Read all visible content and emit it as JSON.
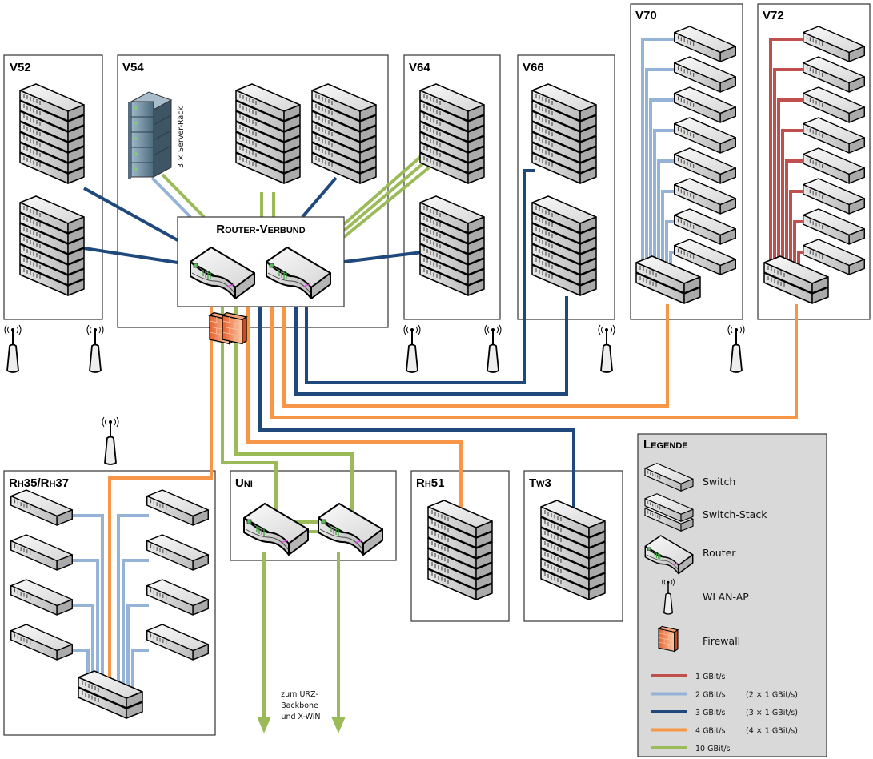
{
  "buildings": {
    "v52": "V52",
    "v54": "V54",
    "v64": "V64",
    "v66": "V66",
    "v70": "V70",
    "v72": "V72",
    "rh35": "Rh35/Rh37",
    "uni": "Uni",
    "rh51": "Rh51",
    "tw3": "Tw3"
  },
  "router_group": "Router-Verbund",
  "server_rack_label": "3 × Server-Rack",
  "uplink_note": [
    "zum URZ-",
    "Backbone",
    "und X-WiN"
  ],
  "colors": {
    "1g": "#c0504d",
    "2g": "#95b3d7",
    "3g": "#1f497d",
    "4g": "#f79646",
    "10g": "#9bbb59"
  },
  "legend": {
    "title": "Legende",
    "symbols": [
      {
        "icon": "switch-icon",
        "label": "Switch"
      },
      {
        "icon": "switch-stack-icon",
        "label": "Switch-Stack"
      },
      {
        "icon": "router-icon",
        "label": "Router"
      },
      {
        "icon": "wlan-ap-icon",
        "label": "WLAN-AP"
      },
      {
        "icon": "firewall-icon",
        "label": "Firewall"
      }
    ],
    "links": [
      {
        "label": "1 GBit/s",
        "detail": "",
        "color": "#c0504d"
      },
      {
        "label": "2 GBit/s",
        "detail": "(2 × 1 GBit/s)",
        "color": "#95b3d7"
      },
      {
        "label": "3 GBit/s",
        "detail": "(3 × 1 GBit/s)",
        "color": "#1f497d"
      },
      {
        "label": "4 GBit/s",
        "detail": "(4 × 1 GBit/s)",
        "color": "#f79646"
      },
      {
        "label": "10 GBit/s",
        "detail": "",
        "color": "#9bbb59"
      }
    ]
  }
}
